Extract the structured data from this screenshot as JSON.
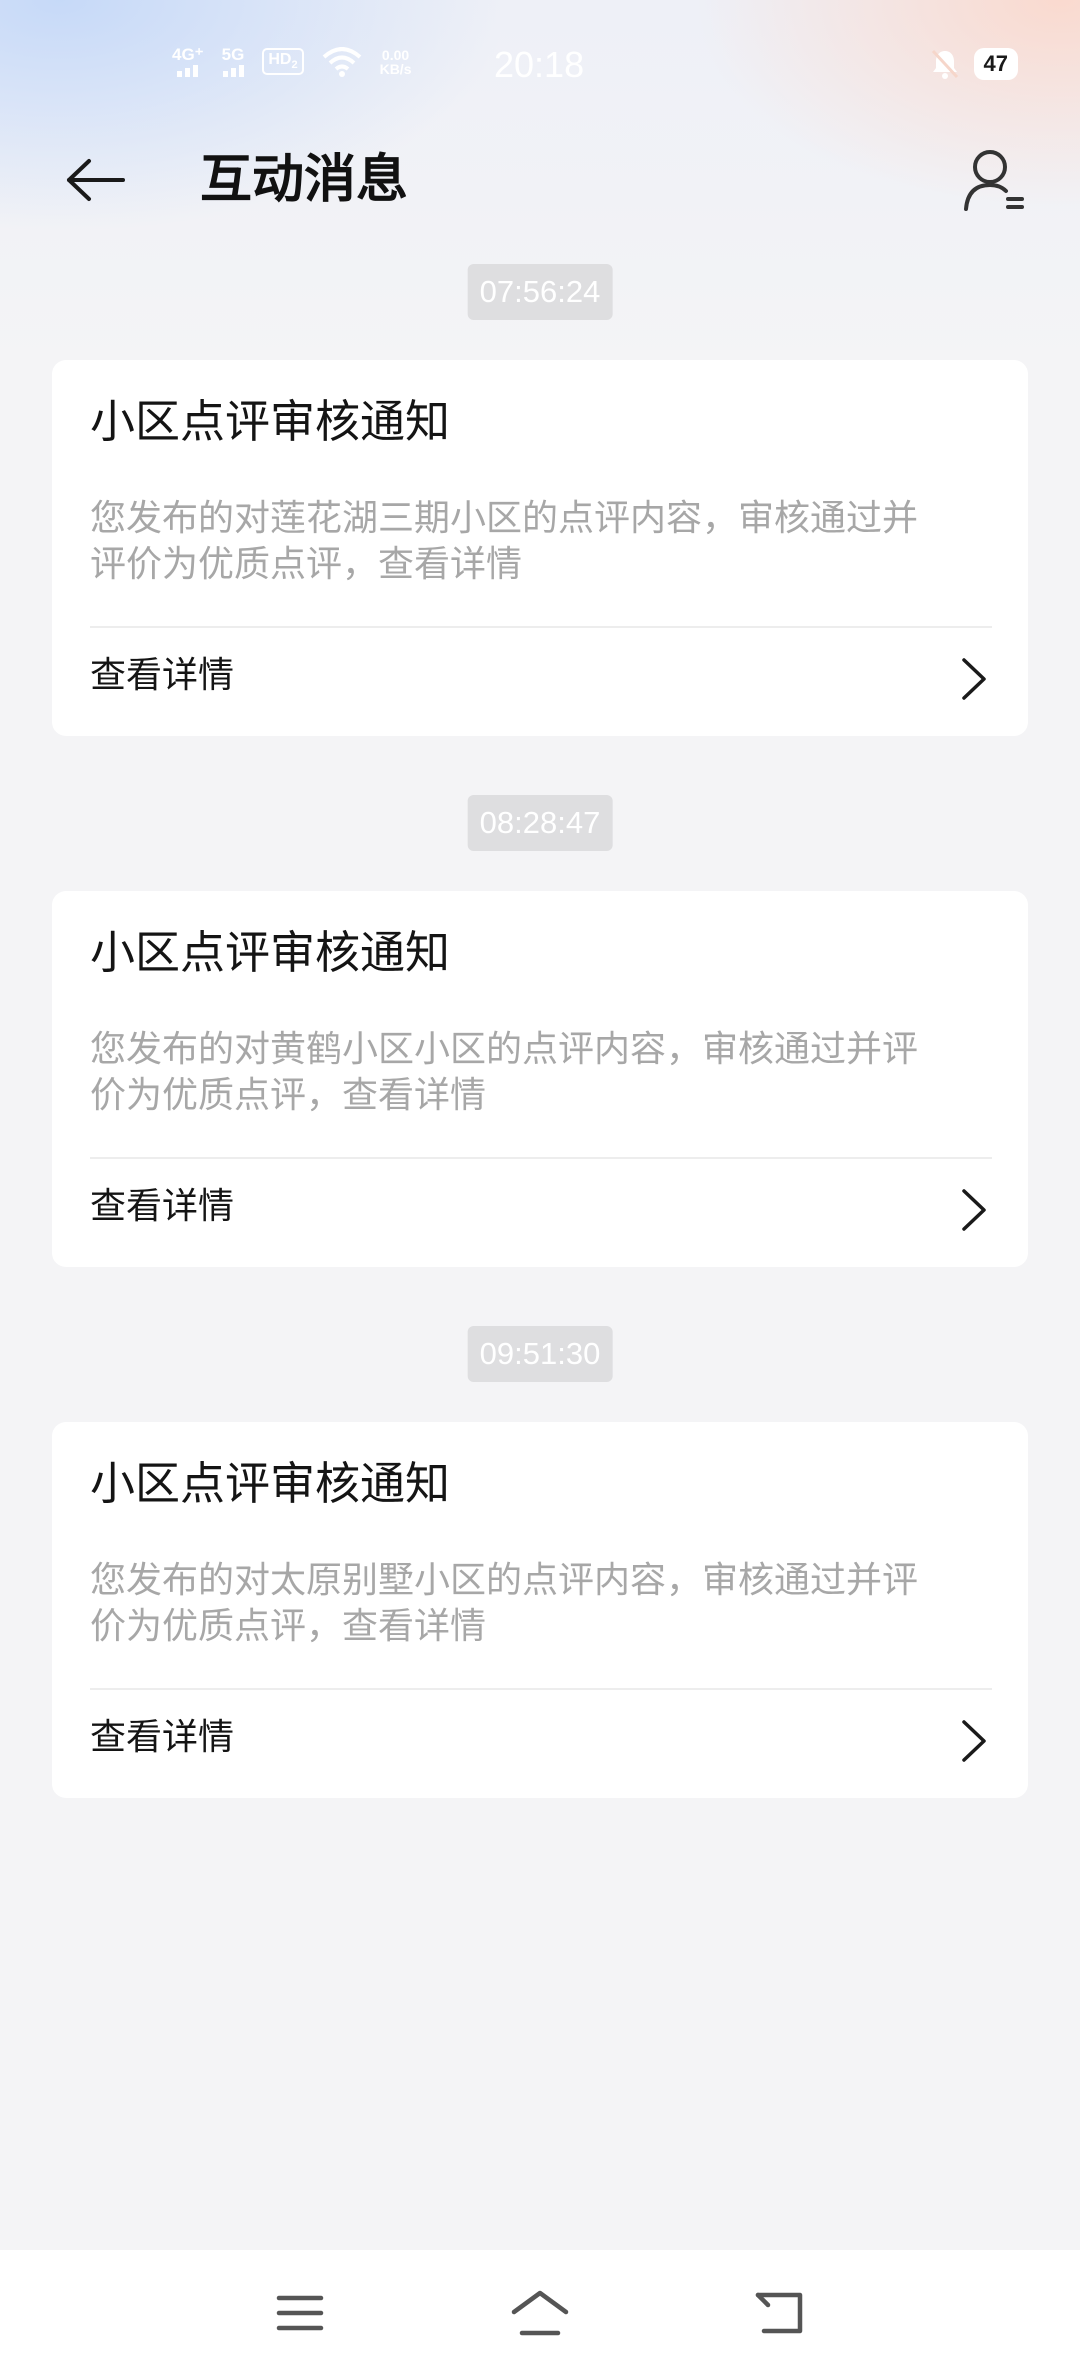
{
  "status_bar": {
    "time": "20:18",
    "network_1": "4G⁺",
    "network_2": "5G",
    "hd_label": "HD",
    "hd_sub": "2",
    "net_speed_value": "0.00",
    "net_speed_unit": "KB/s",
    "battery": "47",
    "icons": [
      "signal-icon",
      "wifi-icon",
      "bell-off-icon",
      "battery-icon"
    ]
  },
  "header": {
    "title": "互动消息",
    "back_icon": "arrow-left-icon",
    "profile_icon": "user-list-icon"
  },
  "messages": [
    {
      "time": "07:56:24",
      "title": "小区点评审核通知",
      "desc_line1": "您发布的对莲花湖三期小区的点评内容，审核通过并",
      "desc_line2": "评价为优质点评，查看详情",
      "link": "查看详情"
    },
    {
      "time": "08:28:47",
      "title": "小区点评审核通知",
      "desc_line1": "您发布的对黄鹤小区小区的点评内容，审核通过并评",
      "desc_line2": "价为优质点评，查看详情",
      "link": "查看详情"
    },
    {
      "time": "09:51:30",
      "title": "小区点评审核通知",
      "desc_line1": "您发布的对太原别墅小区的点评内容，审核通过并评",
      "desc_line2": "价为优质点评，查看详情",
      "link": "查看详情"
    }
  ],
  "nav_bar": {
    "icons": [
      "menu-icon",
      "home-icon",
      "back-icon"
    ]
  },
  "colors": {
    "background": "#f4f4f6",
    "card": "#ffffff",
    "time_chip": "#dedee0",
    "desc_text": "#a7a7a7"
  }
}
